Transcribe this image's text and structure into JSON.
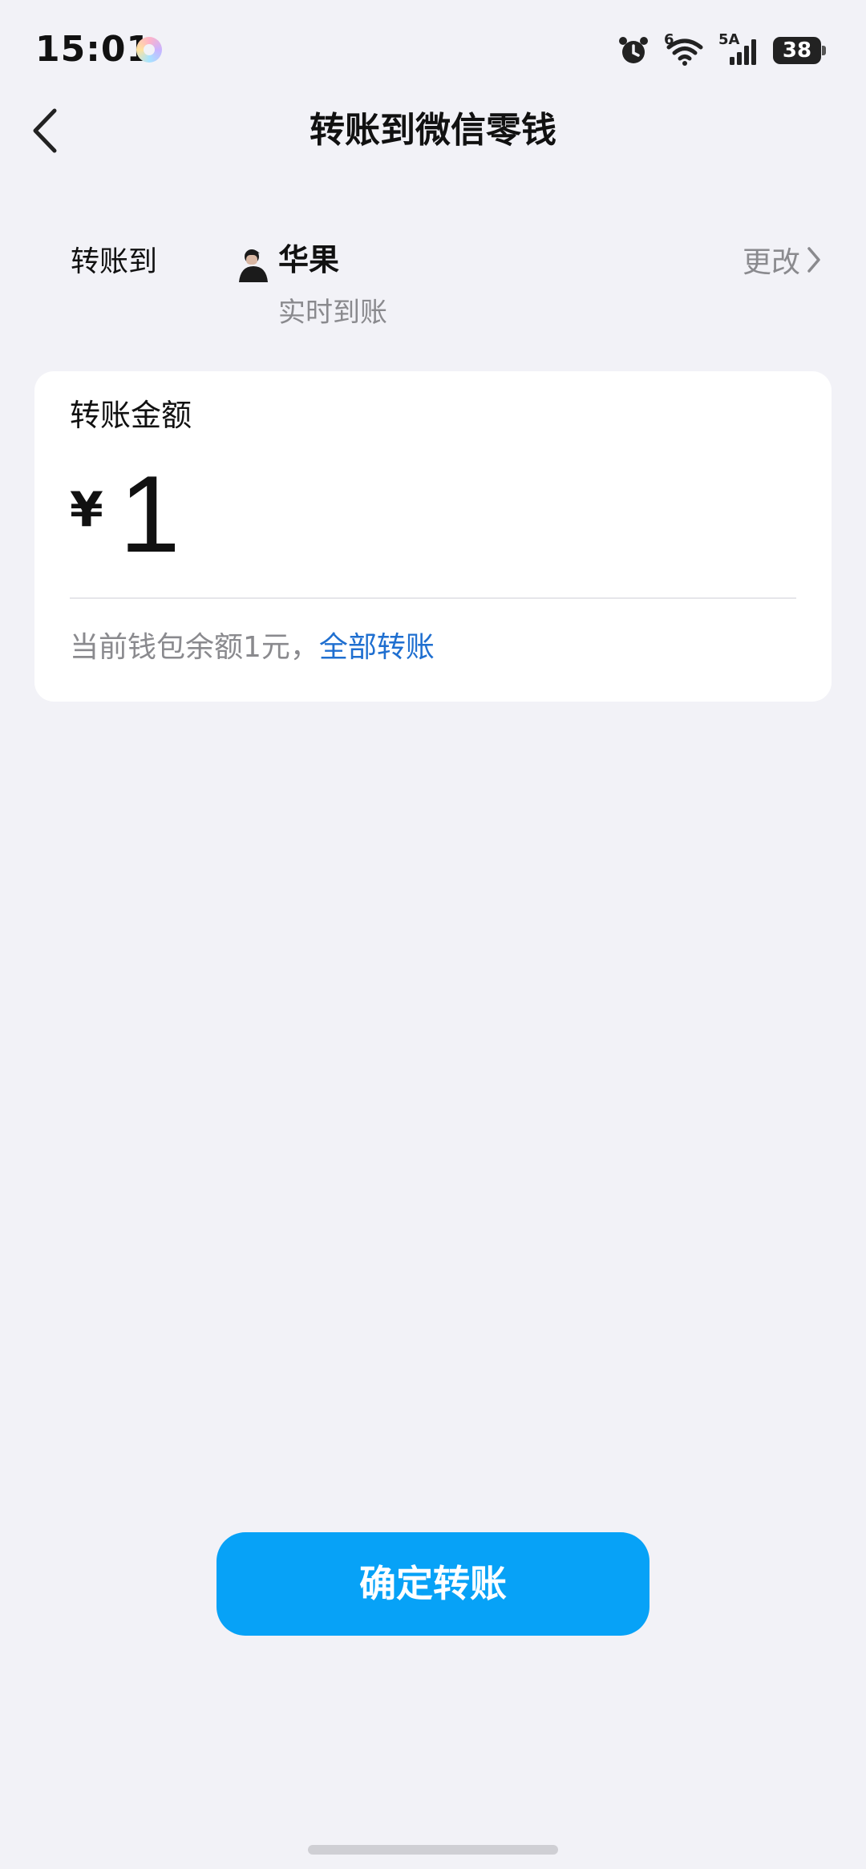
{
  "status_bar": {
    "time": "15:01",
    "network_label": "5A",
    "wifi_label": "6",
    "battery_level": "38"
  },
  "nav": {
    "title": "转账到微信零钱"
  },
  "recipient": {
    "label": "转账到",
    "name": "华果",
    "subtitle": "实时到账",
    "change_label": "更改"
  },
  "amount_card": {
    "label": "转账金额",
    "currency_symbol": "¥",
    "amount": "1",
    "balance_text": "当前钱包余额1元，",
    "transfer_all_label": "全部转账"
  },
  "confirm_button": {
    "label": "确定转账"
  },
  "colors": {
    "page_background": "#f2f2f7",
    "primary_button": "#07a2f7",
    "link_blue": "#1f6fd0",
    "secondary_text": "#8a8a8e"
  },
  "icons": {
    "back": "chevron-left-icon",
    "change_arrow": "chevron-right-icon",
    "alarm": "alarm-icon",
    "wifi": "wifi-icon",
    "signal": "signal-icon",
    "battery": "battery-icon"
  }
}
